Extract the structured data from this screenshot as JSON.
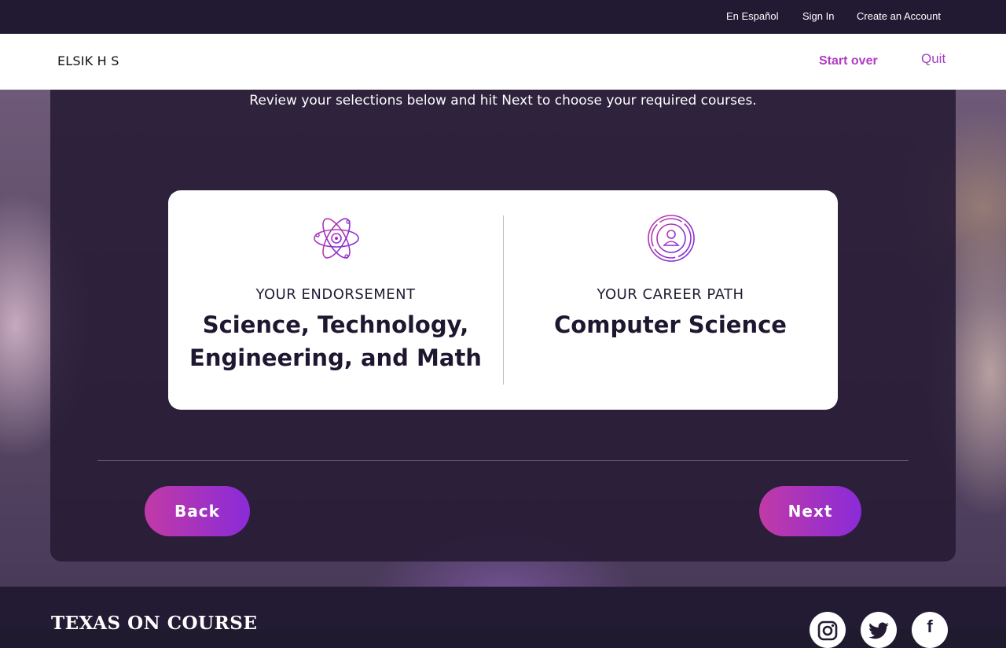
{
  "topbar": {
    "links": [
      "En Español",
      "Sign In",
      "Create an Account"
    ]
  },
  "header": {
    "school_name": "ELSIK H S",
    "start_over": "Start over",
    "quit": "Quit"
  },
  "main": {
    "intro": "Review your selections below and hit Next to choose your required courses.",
    "endorsement": {
      "label": "YOUR ENDORSEMENT",
      "value": "Science, Technology, Engineering, and Math",
      "icon": "atom-icon"
    },
    "career_path": {
      "label": "YOUR CAREER PATH",
      "value": "Computer Science",
      "icon": "target-person-icon"
    },
    "back_button": "Back",
    "next_button": "Next"
  },
  "footer": {
    "logo_text": "TEXAS ON COURSE",
    "social": [
      "instagram-icon",
      "twitter-icon",
      "facebook-icon"
    ]
  },
  "colors": {
    "accent_start": "#c13aa6",
    "accent_end": "#8a2bd8",
    "dark": "#221a33"
  }
}
